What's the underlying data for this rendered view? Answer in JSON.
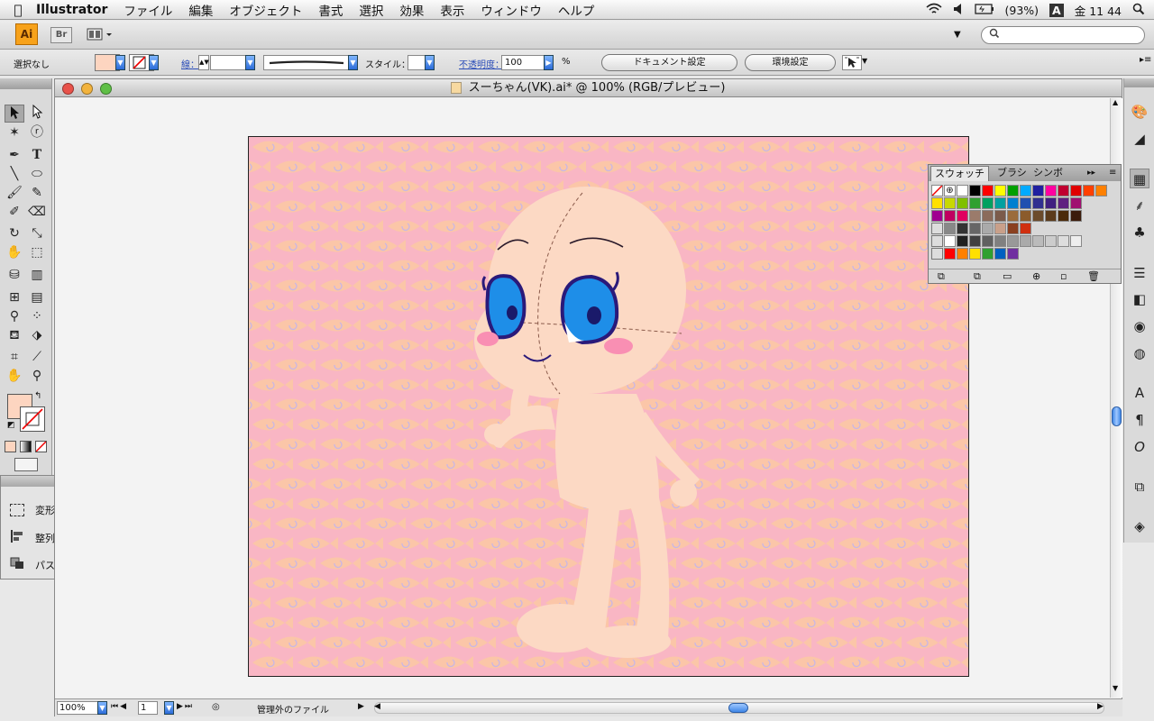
{
  "menubar": {
    "app_name": "Illustrator",
    "items": [
      "ファイル",
      "編集",
      "オブジェクト",
      "書式",
      "選択",
      "効果",
      "表示",
      "ウィンドウ",
      "ヘルプ"
    ],
    "battery": "(93%)",
    "input_method": "A",
    "clock": "金 11 44"
  },
  "appbar": {
    "logo": "Ai",
    "bridge": "Br",
    "search_placeholder": ""
  },
  "control": {
    "selection": "選択なし",
    "stroke_label": "線：",
    "style_label": "スタイル：",
    "opacity_label": "不透明度：",
    "opacity_value": "100",
    "percent": "%",
    "doc_setup": "ドキュメント設定",
    "preferences": "環境設定",
    "fill_color": "#fdd5c0"
  },
  "document": {
    "title": "スーちゃん(VK).ai* @ 100% (RGB/プレビュー)",
    "zoom": "100%",
    "page": "1",
    "status": "管理外のファイル"
  },
  "float_panel": {
    "items": [
      "変形",
      "整列",
      "パスファインダ"
    ]
  },
  "swatches": {
    "tabs": [
      "スウォッチ",
      "ブラシ",
      "シンボ"
    ],
    "row1": [
      "#ffffff",
      "#000000",
      "#ff0000",
      "#ffff00",
      "#00a000",
      "#00aaff",
      "#2020a0",
      "#ff00a0",
      "#c00030",
      "#e00000",
      "#ff4000",
      "#ff8000"
    ],
    "row2": [
      "#ffe000",
      "#c8d800",
      "#80c000",
      "#30a030",
      "#00a060",
      "#00a0a0",
      "#0080d0",
      "#2050b0",
      "#303090",
      "#402080",
      "#602080",
      "#a01070"
    ],
    "row3": [
      "#a00090",
      "#c00060",
      "#e00060",
      "#9b7b6b",
      "#8b6b5b",
      "#7b5b4b",
      "#9b6b3b",
      "#8b5b2b",
      "#6b4b2b",
      "#5b3b1b",
      "#4b2b0b",
      "#3b1b0b"
    ],
    "grays": [
      "#ffffff",
      "#202020",
      "#404040",
      "#606060",
      "#808080",
      "#999999",
      "#aaaaaa",
      "#bbbbbb",
      "#cccccc",
      "#dddddd",
      "#eeeeee"
    ],
    "group2": [
      "#ff0000",
      "#ff8000",
      "#ffe000",
      "#30a030",
      "#0060c0",
      "#7030a0"
    ]
  },
  "artwork": {
    "skin": "#fcd9c4",
    "bg_pink": "#f9b6c4",
    "bg_peach": "#fbc2a8",
    "eye_blue": "#1e8ee8",
    "eye_outline": "#2a1a7a",
    "blush": "#f98fb3"
  }
}
